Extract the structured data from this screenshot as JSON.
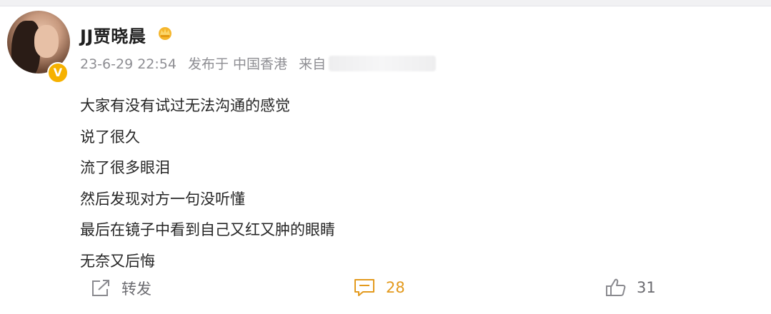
{
  "post": {
    "author": "JJ贾晓晨",
    "timestamp": "23-6-29 22:54",
    "published_in": "发布于 中国香港",
    "source_prefix": "来自",
    "lines": [
      "大家有没有试过无法沟通的感觉",
      "说了很久",
      "流了很多眼泪",
      "然后发现对方一句没听懂",
      "最后在镜子中看到自己又红又肿的眼睛",
      "无奈又后悔"
    ]
  },
  "actions": {
    "repost_label": "转发",
    "comment_count": "28",
    "like_count": "31"
  },
  "icons": {
    "verified": "verified-v-icon",
    "member": "crown-icon",
    "repost": "share-icon",
    "comment": "comment-icon",
    "like": "thumbs-up-icon"
  },
  "colors": {
    "accent": "#e39a1e",
    "verified_badge": "#f6b100",
    "meta_text": "#8e8e93"
  }
}
